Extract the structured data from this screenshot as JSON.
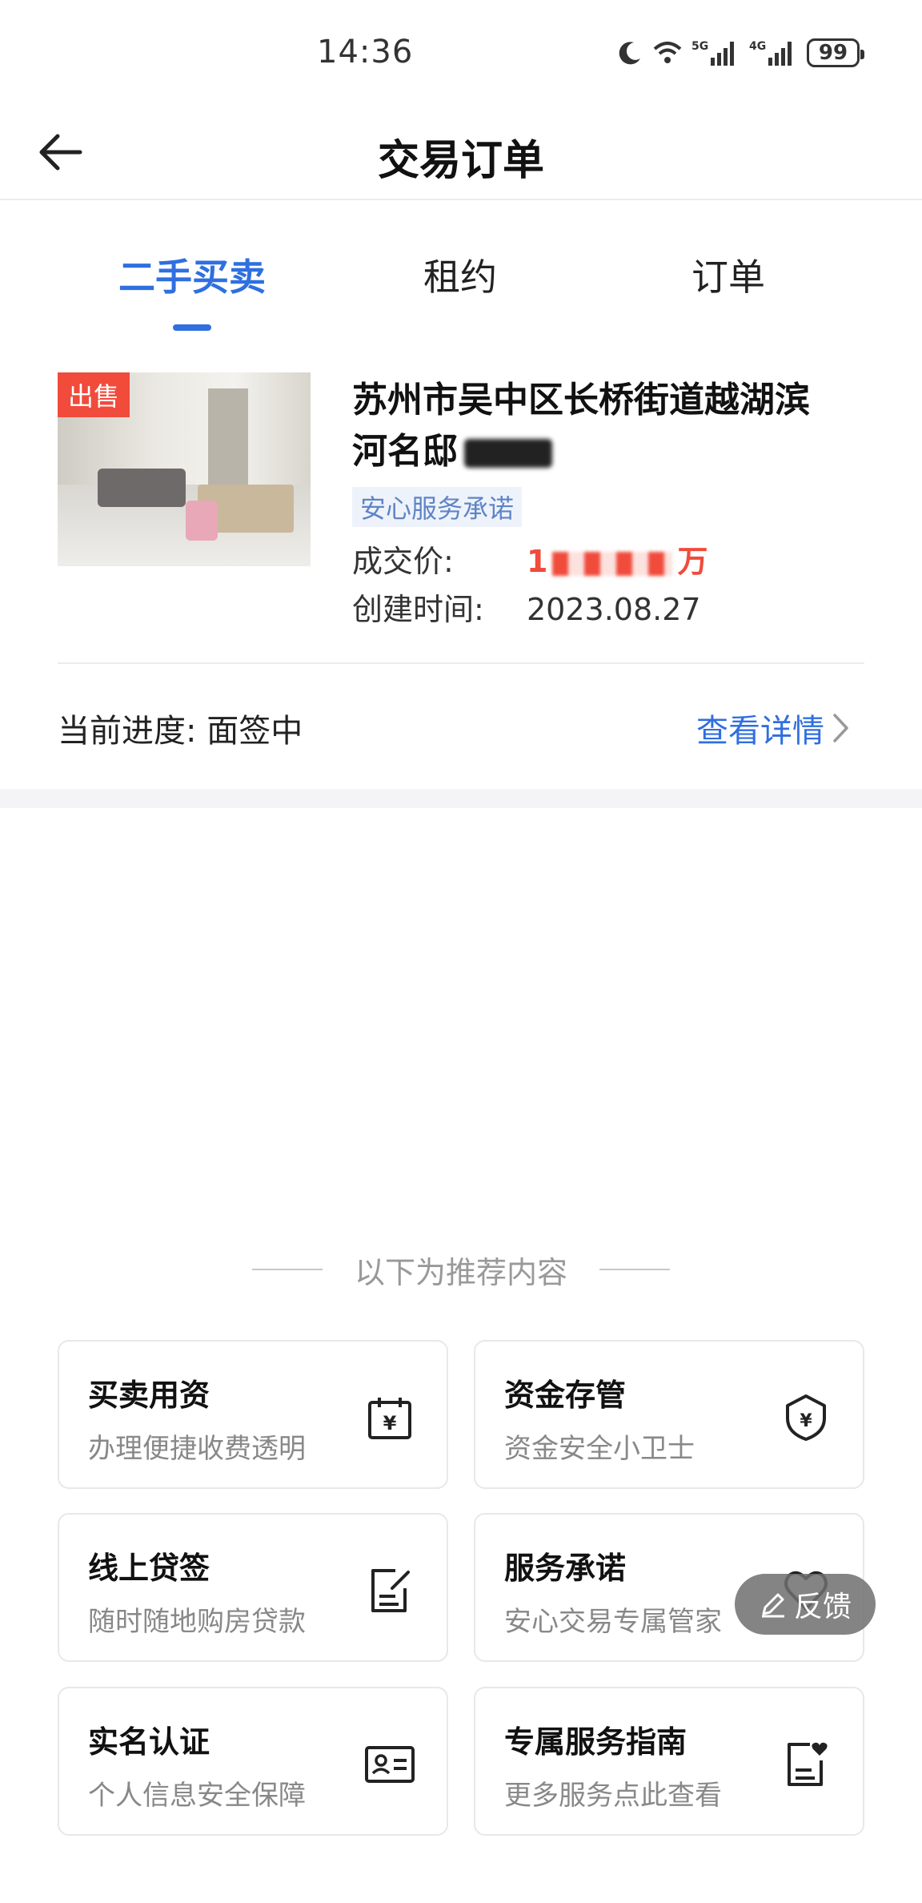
{
  "status_bar": {
    "time": "14:36",
    "battery": "99"
  },
  "header": {
    "title": "交易订单"
  },
  "tabs": [
    {
      "label": "二手买卖"
    },
    {
      "label": "租约"
    },
    {
      "label": "订单"
    }
  ],
  "order": {
    "tag": "出售",
    "address_line1": "苏州市吴中区长桥街道越湖滨",
    "address_line2": "河名邸",
    "service_tag": "安心服务承诺",
    "price_label": "成交价:",
    "price_prefix": "1",
    "price_unit": "万",
    "created_label": "创建时间:",
    "created_value": "2023.08.27",
    "progress_label": "当前进度:",
    "progress_value": "面签中",
    "detail_link": "查看详情"
  },
  "recommend": {
    "header": "以下为推荐内容",
    "cards": [
      {
        "title": "买卖用资",
        "sub": "办理便捷收费透明",
        "icon": "calendar-yen-icon"
      },
      {
        "title": "资金存管",
        "sub": "资金安全小卫士",
        "icon": "shield-yen-icon"
      },
      {
        "title": "线上贷签",
        "sub": "随时随地购房贷款",
        "icon": "sign-document-icon"
      },
      {
        "title": "服务承诺",
        "sub": "安心交易专属管家",
        "icon": "heart-icon"
      },
      {
        "title": "实名认证",
        "sub": "个人信息安全保障",
        "icon": "id-card-icon"
      },
      {
        "title": "专属服务指南",
        "sub": "更多服务点此查看",
        "icon": "guide-document-icon"
      }
    ]
  },
  "feedback": {
    "label": "反馈"
  },
  "colors": {
    "accent": "#2f6fe0",
    "price": "#f04b3b",
    "sale_tag": "#f04b3b"
  }
}
